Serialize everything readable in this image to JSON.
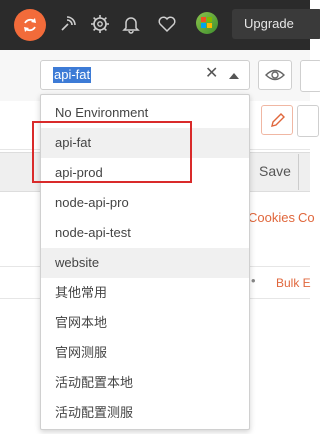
{
  "header": {
    "upgrade_label": "Upgrade"
  },
  "environment": {
    "selected": "api-fat",
    "options": [
      "No Environment",
      "api-fat",
      "api-prod",
      "node-api-pro",
      "node-api-test",
      "website",
      "其他常用",
      "官网本地",
      "官网测服",
      "活动配置本地",
      "活动配置测服"
    ]
  },
  "workspace": {
    "save_label": "Save",
    "cookies_label": "Cookies",
    "cookies_cut_label": "Co",
    "bulk_edit_label": "Bulk E"
  },
  "colors": {
    "accent": "#f26b3a",
    "header_bg": "#2b2b2b",
    "selection": "#3d7bd6",
    "annotation": "#d92a2a",
    "link": "#e0673c"
  }
}
